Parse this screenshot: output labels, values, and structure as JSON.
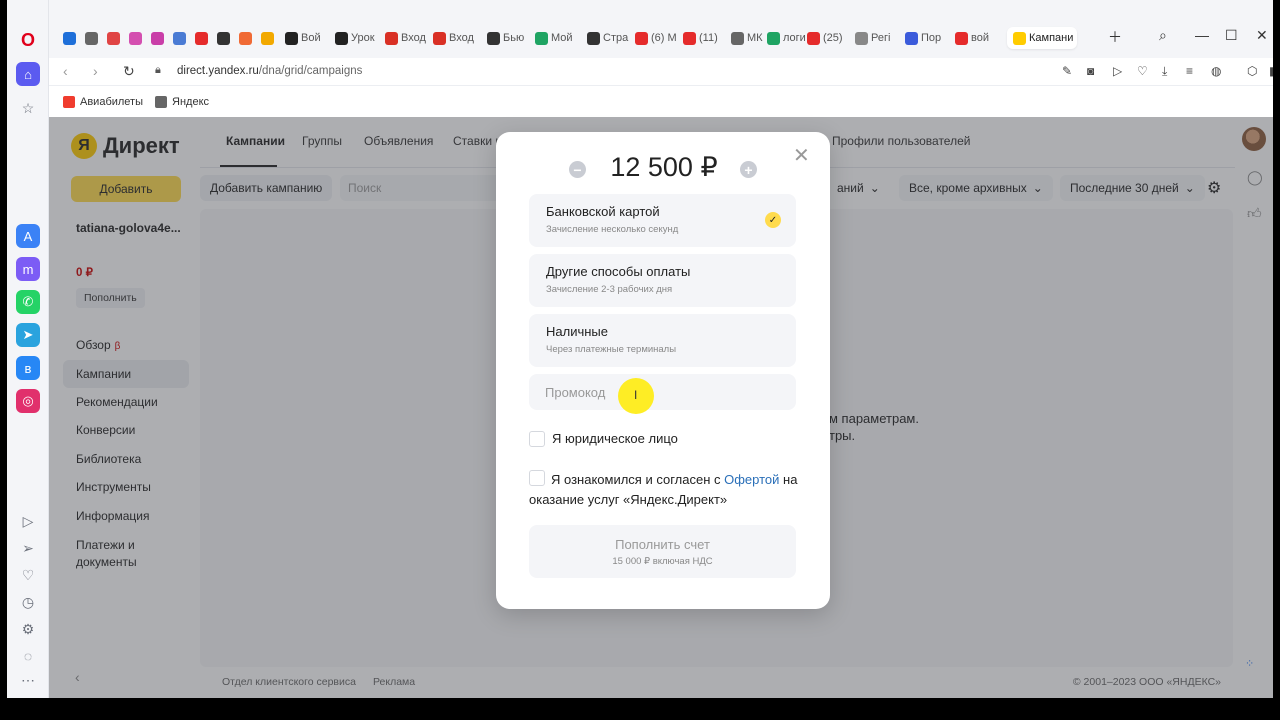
{
  "browser": {
    "tabs": [
      {
        "label": "",
        "color": "#1e6fd9"
      },
      {
        "label": "",
        "color": "#666"
      },
      {
        "label": "",
        "color": "#e04444"
      },
      {
        "label": "",
        "color": "#d44fb0"
      },
      {
        "label": "",
        "color": "#c93ea8"
      },
      {
        "label": "",
        "color": "#4a7bd4"
      },
      {
        "label": "",
        "color": "#e52b2b"
      },
      {
        "label": "",
        "color": "#333"
      },
      {
        "label": "",
        "color": "#f06a35"
      },
      {
        "label": "",
        "color": "#f2a900"
      },
      {
        "label": "Вой",
        "color": "#222"
      },
      {
        "label": "Урок",
        "color": "#222"
      },
      {
        "label": "Вход",
        "color": "#d93025"
      },
      {
        "label": "Вход",
        "color": "#d93025"
      },
      {
        "label": "Бью",
        "color": "#333"
      },
      {
        "label": "Мой",
        "color": "#1fa463"
      },
      {
        "label": "Стра",
        "color": "#333"
      },
      {
        "label": "(6) M",
        "color": "#e52b2b"
      },
      {
        "label": "(11)",
        "color": "#e52b2b"
      },
      {
        "label": "МК",
        "color": "#666"
      },
      {
        "label": "логи",
        "color": "#1fa463"
      },
      {
        "label": "(25)",
        "color": "#e52b2b"
      },
      {
        "label": "Регі",
        "color": "#888"
      },
      {
        "label": "Пор",
        "color": "#3b5bdb"
      },
      {
        "label": "вой",
        "color": "#e52b2b"
      },
      {
        "label": "Кампани",
        "color": "#ffcc00"
      }
    ],
    "url_host": "direct.yandex.ru",
    "url_path": "/dna/grid/campaigns",
    "bookmarks": [
      "Авиабилеты",
      "Яндекс"
    ]
  },
  "app": {
    "logo": "Директ",
    "add_button": "Добавить",
    "account": "tatiana-golova4e...",
    "balance": "0 ₽",
    "topup_small": "Пополнить",
    "sidebar": [
      "Обзор",
      "Кампании",
      "Рекомендации",
      "Конверсии",
      "Библиотека",
      "Инструменты",
      "Информация",
      "Платежи и документы"
    ],
    "beta_mark": "β",
    "topnav": [
      "Кампании",
      "Группы",
      "Объявления",
      "Ставки и",
      "Профили пользователей"
    ],
    "add_campaign": "Добавить кампанию",
    "search_placeholder": "Поиск",
    "filters": [
      "аний",
      "Все, кроме архивных",
      "Последние 30 дней"
    ],
    "empty_line1": "м параметрам.",
    "empty_line2": "тры.",
    "footer_left": [
      "Отдел клиентского сервиса",
      "Реклама"
    ],
    "footer_right": "© 2001–2023 ООО «ЯНДЕКС»"
  },
  "modal": {
    "amount": "12 500 ₽",
    "options": [
      {
        "title": "Банковской картой",
        "subtitle": "Зачисление несколько секунд",
        "selected": true
      },
      {
        "title": "Другие способы оплаты",
        "subtitle": "Зачисление 2-3 рабочих дня",
        "selected": false
      },
      {
        "title": "Наличные",
        "subtitle": "Через платежные терминалы",
        "selected": false
      }
    ],
    "promo_placeholder": "Промокод",
    "legal_entity": "Я юридическое лицо",
    "agree_prefix": "Я ознакомился и согласен с ",
    "agree_link": "Офертой",
    "agree_suffix": " на оказание услуг «Яндекс.Директ»",
    "topup_title": "Пополнить счет",
    "topup_subtitle": "15 000 ₽ включая НДС"
  }
}
